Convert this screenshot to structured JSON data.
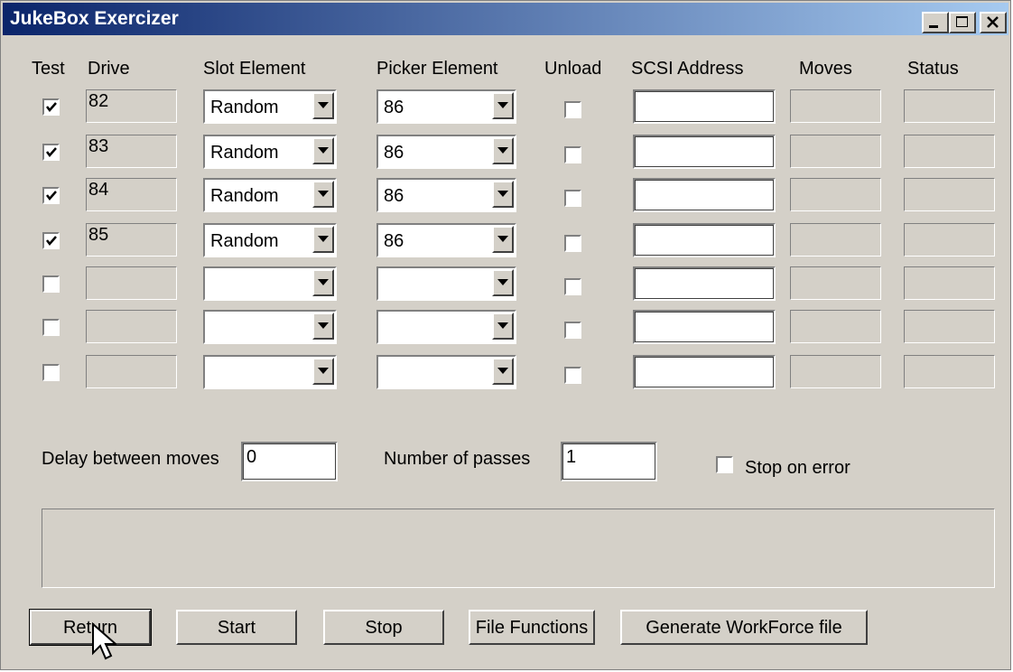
{
  "window": {
    "title": "JukeBox Exercizer"
  },
  "headers": {
    "test": "Test",
    "drive": "Drive",
    "slot": "Slot Element",
    "picker": "Picker Element",
    "unload": "Unload",
    "scsi": "SCSI Address",
    "moves": "Moves",
    "status": "Status"
  },
  "rows": [
    {
      "test": true,
      "drive": "82",
      "slot": "Random",
      "picker": "86",
      "unload": false,
      "scsi": "",
      "moves": "",
      "status": ""
    },
    {
      "test": true,
      "drive": "83",
      "slot": "Random",
      "picker": "86",
      "unload": false,
      "scsi": "",
      "moves": "",
      "status": ""
    },
    {
      "test": true,
      "drive": "84",
      "slot": "Random",
      "picker": "86",
      "unload": false,
      "scsi": "",
      "moves": "",
      "status": ""
    },
    {
      "test": true,
      "drive": "85",
      "slot": "Random",
      "picker": "86",
      "unload": false,
      "scsi": "",
      "moves": "",
      "status": ""
    },
    {
      "test": false,
      "drive": "",
      "slot": "",
      "picker": "",
      "unload": false,
      "scsi": "",
      "moves": "",
      "status": ""
    },
    {
      "test": false,
      "drive": "",
      "slot": "",
      "picker": "",
      "unload": false,
      "scsi": "",
      "moves": "",
      "status": ""
    },
    {
      "test": false,
      "drive": "",
      "slot": "",
      "picker": "",
      "unload": false,
      "scsi": "",
      "moves": "",
      "status": ""
    }
  ],
  "options": {
    "delay_label": "Delay between moves",
    "delay_value": "0",
    "passes_label": "Number of passes",
    "passes_value": "1",
    "stop_on_error_label": "Stop on error",
    "stop_on_error": false
  },
  "buttons": {
    "return": "Return",
    "start": "Start",
    "stop": "Stop",
    "file_functions": "File Functions",
    "generate": "Generate WorkForce file"
  }
}
